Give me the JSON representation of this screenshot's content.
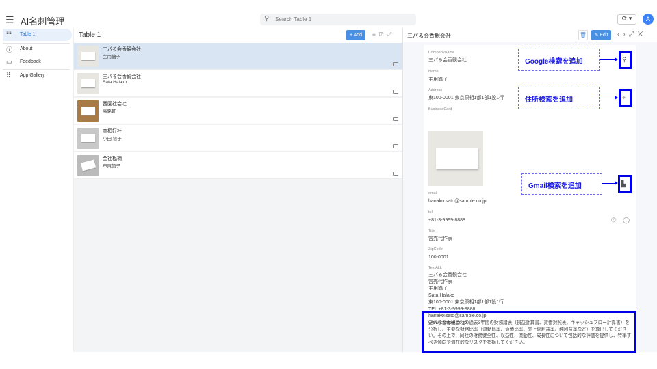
{
  "app": {
    "title": "AI名刺管理",
    "search_placeholder": "Search Table 1",
    "avatar": "A"
  },
  "sidebar": {
    "items": [
      {
        "label": "Table 1",
        "icon": "list-icon"
      },
      {
        "label": "About",
        "icon": "info-icon"
      },
      {
        "label": "Feedback",
        "icon": "feedback-icon"
      },
      {
        "label": "App Gallery",
        "icon": "apps-grid-icon"
      }
    ]
  },
  "list": {
    "title": "Table 1",
    "add_label": "+ Add",
    "rows": [
      {
        "company": "三パる会香観会社",
        "name": "主用鶴子"
      },
      {
        "company": "三パる会香観会社",
        "name": "Sata Halako"
      },
      {
        "company": "西園社会社",
        "name": "高銘軒"
      },
      {
        "company": "查桓好社",
        "name": "小田 袷子"
      },
      {
        "company": "金社榀楠",
        "name": "市東箇子"
      }
    ]
  },
  "detail": {
    "title": "三パる会香観会社",
    "edit_label": "Edit",
    "fields": {
      "company_label": "CompanyName",
      "company": "三パる会香観会社",
      "name_label": "Name",
      "name": "主用鶴子",
      "address_label": "Address",
      "address": "東100-0001 東京原相1都1部1設1行",
      "card_label": "BusinessCard",
      "email_label": "email",
      "email": "hanako.sato@sample.co.jp",
      "tel_label": "tel",
      "tel": "+81-3-9999-8888",
      "title_label": "Title",
      "title": "営売代作表",
      "zip_label": "ZipCode",
      "zip": "100-0001",
      "textall_label": "TextALL",
      "textall": [
        "三パる会香観会社",
        "営売代作表",
        "主用鶴子",
        "Sata Halako",
        "東100-0001 東京原相1都1部1設1行",
        "TEL +81-3-9999-8888",
        "hanako.sato@sample.co.jp",
        "www.sample.co.jp"
      ],
      "deep_label": "Deep Reserch",
      "deep": "三パる会香観会社の過去3年間の財務諸表（損益計算書、貸借対照表、キャッシュフロー計算書）を分析し、主要な財務比率（流動比率、負債比率、売上総利益率、純利益率など）を算出してください。その上で、同社の財務健全性、収益性、流動性、成長性について包括的な評価を提供し、特筆すべき傾向や潜在的なリスクを指摘してください。"
    }
  },
  "annotations": {
    "google": "Google検索を追加",
    "address": "住所検索を追加",
    "gmail": "Gmail検索を追加"
  }
}
